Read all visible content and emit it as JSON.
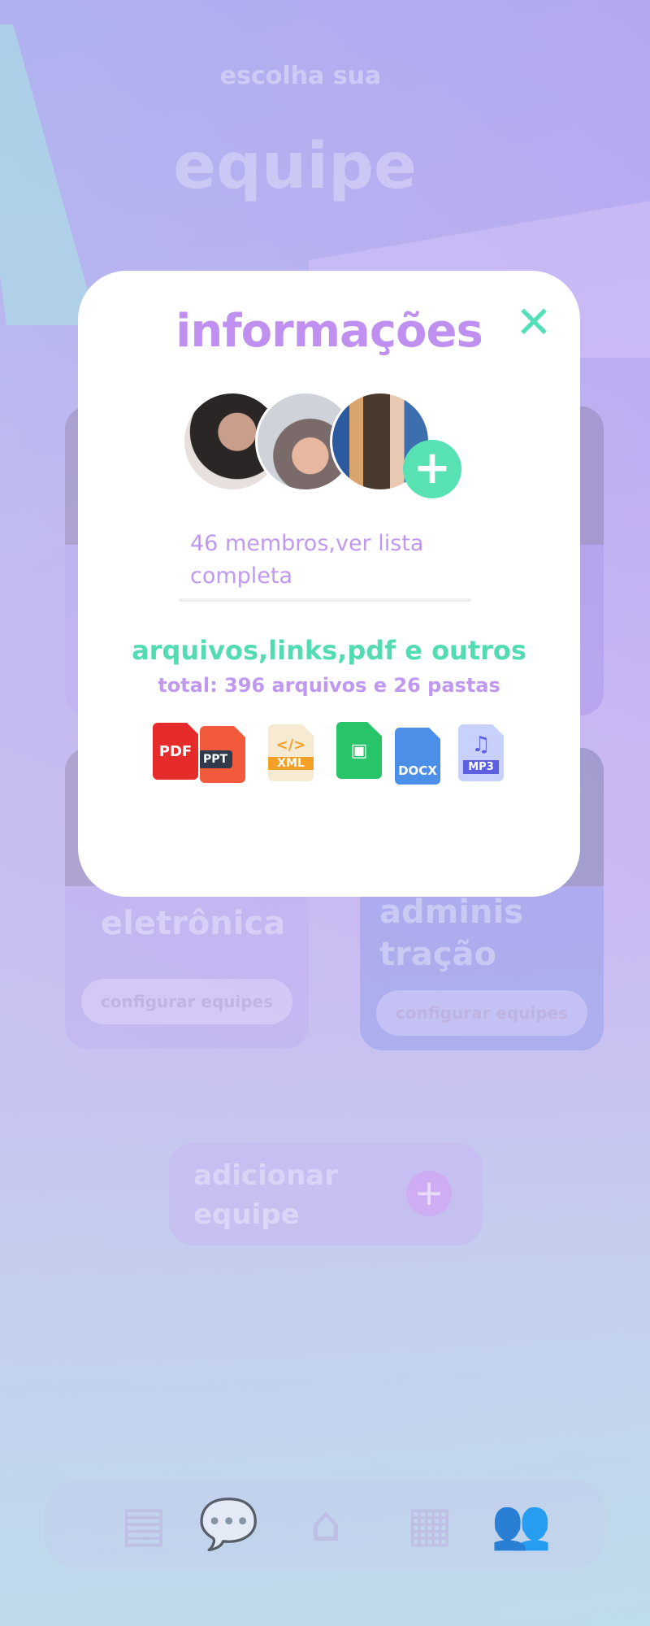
{
  "background": {
    "title_small": "escolha sua",
    "title_big": "equipe",
    "cards": [
      {
        "label": "eletrônica",
        "button": "configurar equipes"
      },
      {
        "label": "adminis\ntração",
        "button": "configurar equipes"
      }
    ],
    "add_team": {
      "label": "adicionar\nequipe",
      "plus": "+"
    }
  },
  "bottom_nav": {
    "items": [
      {
        "name": "tasks",
        "icon": "clipboard-icon"
      },
      {
        "name": "chat",
        "icon": "chat-icon"
      },
      {
        "name": "home",
        "icon": "home-icon"
      },
      {
        "name": "calendar",
        "icon": "calendar-icon"
      },
      {
        "name": "teams",
        "icon": "group-icon",
        "active": true
      }
    ]
  },
  "modal": {
    "title": "informações",
    "close_symbol": "✕",
    "add_member_symbol": "+",
    "members_text": "46 membros,ver lista completa",
    "files_title": "arquivos,links,pdf e outros",
    "files_total": "total: 396 arquivos e 26 pastas",
    "file_types": [
      {
        "name": "pdf",
        "label": "PDF"
      },
      {
        "name": "ppt",
        "label": "PPT"
      },
      {
        "name": "xml",
        "label": "XML",
        "glyph": "</>"
      },
      {
        "name": "image",
        "label": "",
        "glyph": "▣"
      },
      {
        "name": "docx",
        "label": "DOCX"
      },
      {
        "name": "mp3",
        "label": "MP3",
        "glyph": "♫"
      }
    ]
  },
  "colors": {
    "accent_purple": "#bf90f0",
    "accent_green": "#53dbb4"
  }
}
